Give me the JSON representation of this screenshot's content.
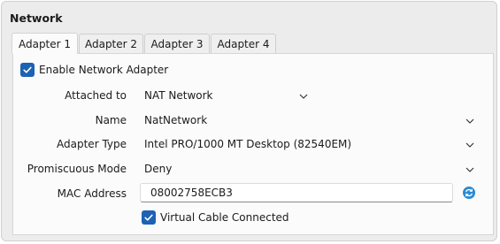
{
  "section": {
    "title": "Network"
  },
  "tabs": [
    {
      "label": "Adapter 1",
      "active": true
    },
    {
      "label": "Adapter 2",
      "active": false
    },
    {
      "label": "Adapter 3",
      "active": false
    },
    {
      "label": "Adapter 4",
      "active": false
    }
  ],
  "enable_adapter": {
    "label": "Enable Network Adapter",
    "checked": true
  },
  "fields": {
    "attached_to": {
      "label": "Attached to",
      "value": "NAT Network"
    },
    "name": {
      "label": "Name",
      "value": "NatNetwork"
    },
    "adapter_type": {
      "label": "Adapter Type",
      "value": "Intel PRO/1000 MT Desktop (82540EM)"
    },
    "promiscuous_mode": {
      "label": "Promiscuous Mode",
      "value": "Deny"
    },
    "mac_address": {
      "label": "MAC Address",
      "value": "08002758ECB3"
    }
  },
  "cable_connected": {
    "label": "Virtual Cable Connected",
    "checked": true
  },
  "icons": {
    "refresh": "refresh-mac-icon",
    "chevron": "chevron-down-icon",
    "check": "checkmark-icon"
  },
  "colors": {
    "accent": "#1d62b5",
    "refresh_icon": "#2a8ad4"
  }
}
